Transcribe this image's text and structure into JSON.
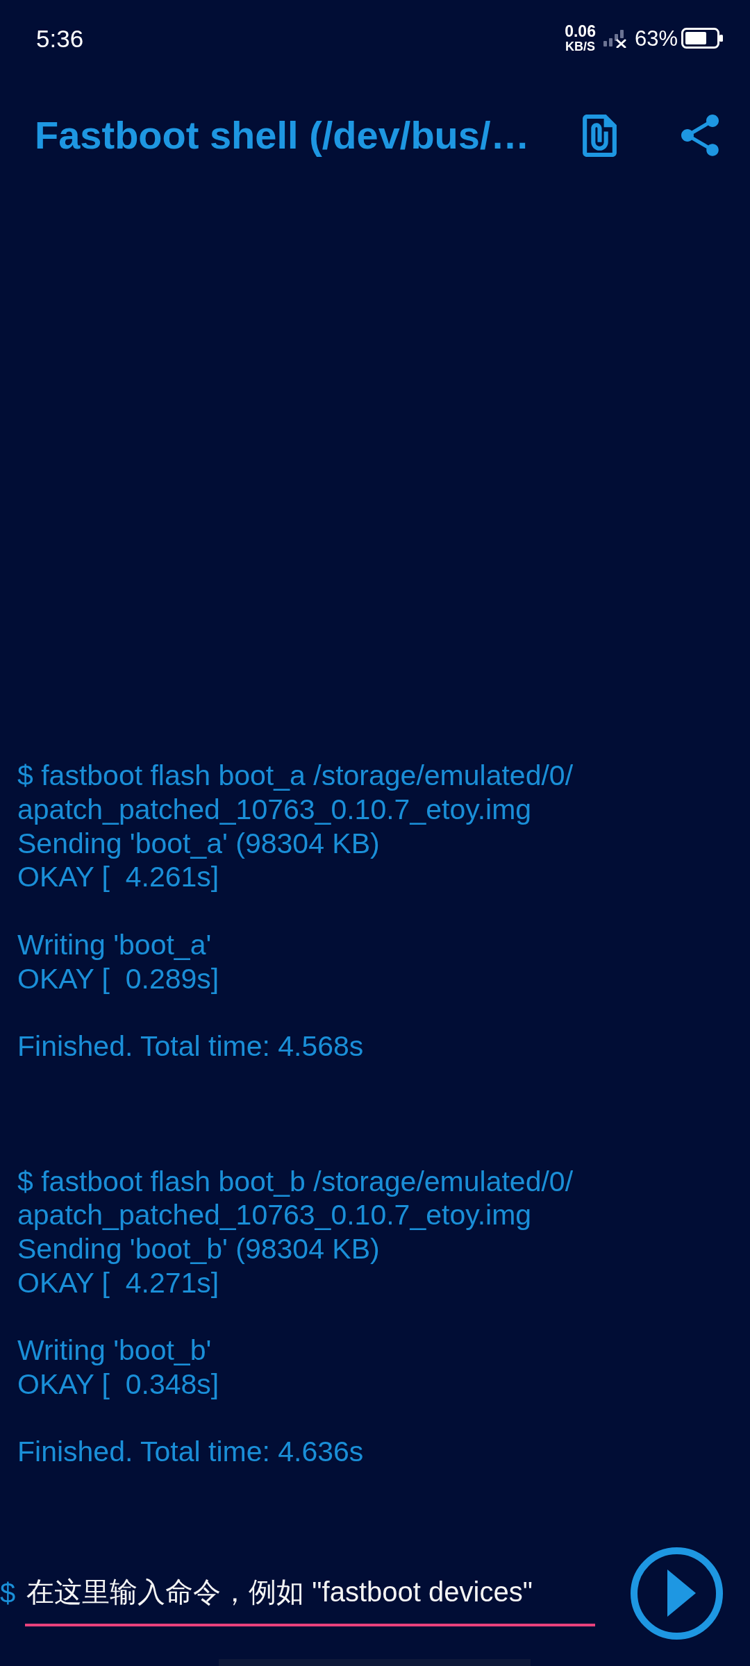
{
  "status_bar": {
    "time": "5:36",
    "net_speed": {
      "value": "0.06",
      "unit": "KB/S"
    },
    "battery": "63%"
  },
  "app_bar": {
    "title": "Fastboot shell (/dev/bus/…"
  },
  "log": {
    "sessions": [
      {
        "groups": [
          {
            "lines": [
              "$ fastboot flash boot_a /storage/emulated/0/",
              "apatch_patched_10763_0.10.7_etoy.img",
              "Sending 'boot_a' (98304 KB)",
              "OKAY [  4.261s]"
            ]
          },
          {
            "lines": [
              "Writing 'boot_a'",
              "OKAY [  0.289s]"
            ]
          },
          {
            "lines": [
              "Finished. Total time: 4.568s"
            ]
          }
        ]
      },
      {
        "groups": [
          {
            "lines": [
              "$ fastboot flash boot_b /storage/emulated/0/",
              "apatch_patched_10763_0.10.7_etoy.img",
              "Sending 'boot_b' (98304 KB)",
              "OKAY [  4.271s]"
            ]
          },
          {
            "lines": [
              "Writing 'boot_b'",
              "OKAY [  0.348s]"
            ]
          },
          {
            "lines": [
              "Finished. Total time: 4.636s"
            ]
          }
        ]
      }
    ]
  },
  "command_bar": {
    "prompt": "$",
    "placeholder": "在这里输入命令，例如 \"fastboot devices\""
  }
}
